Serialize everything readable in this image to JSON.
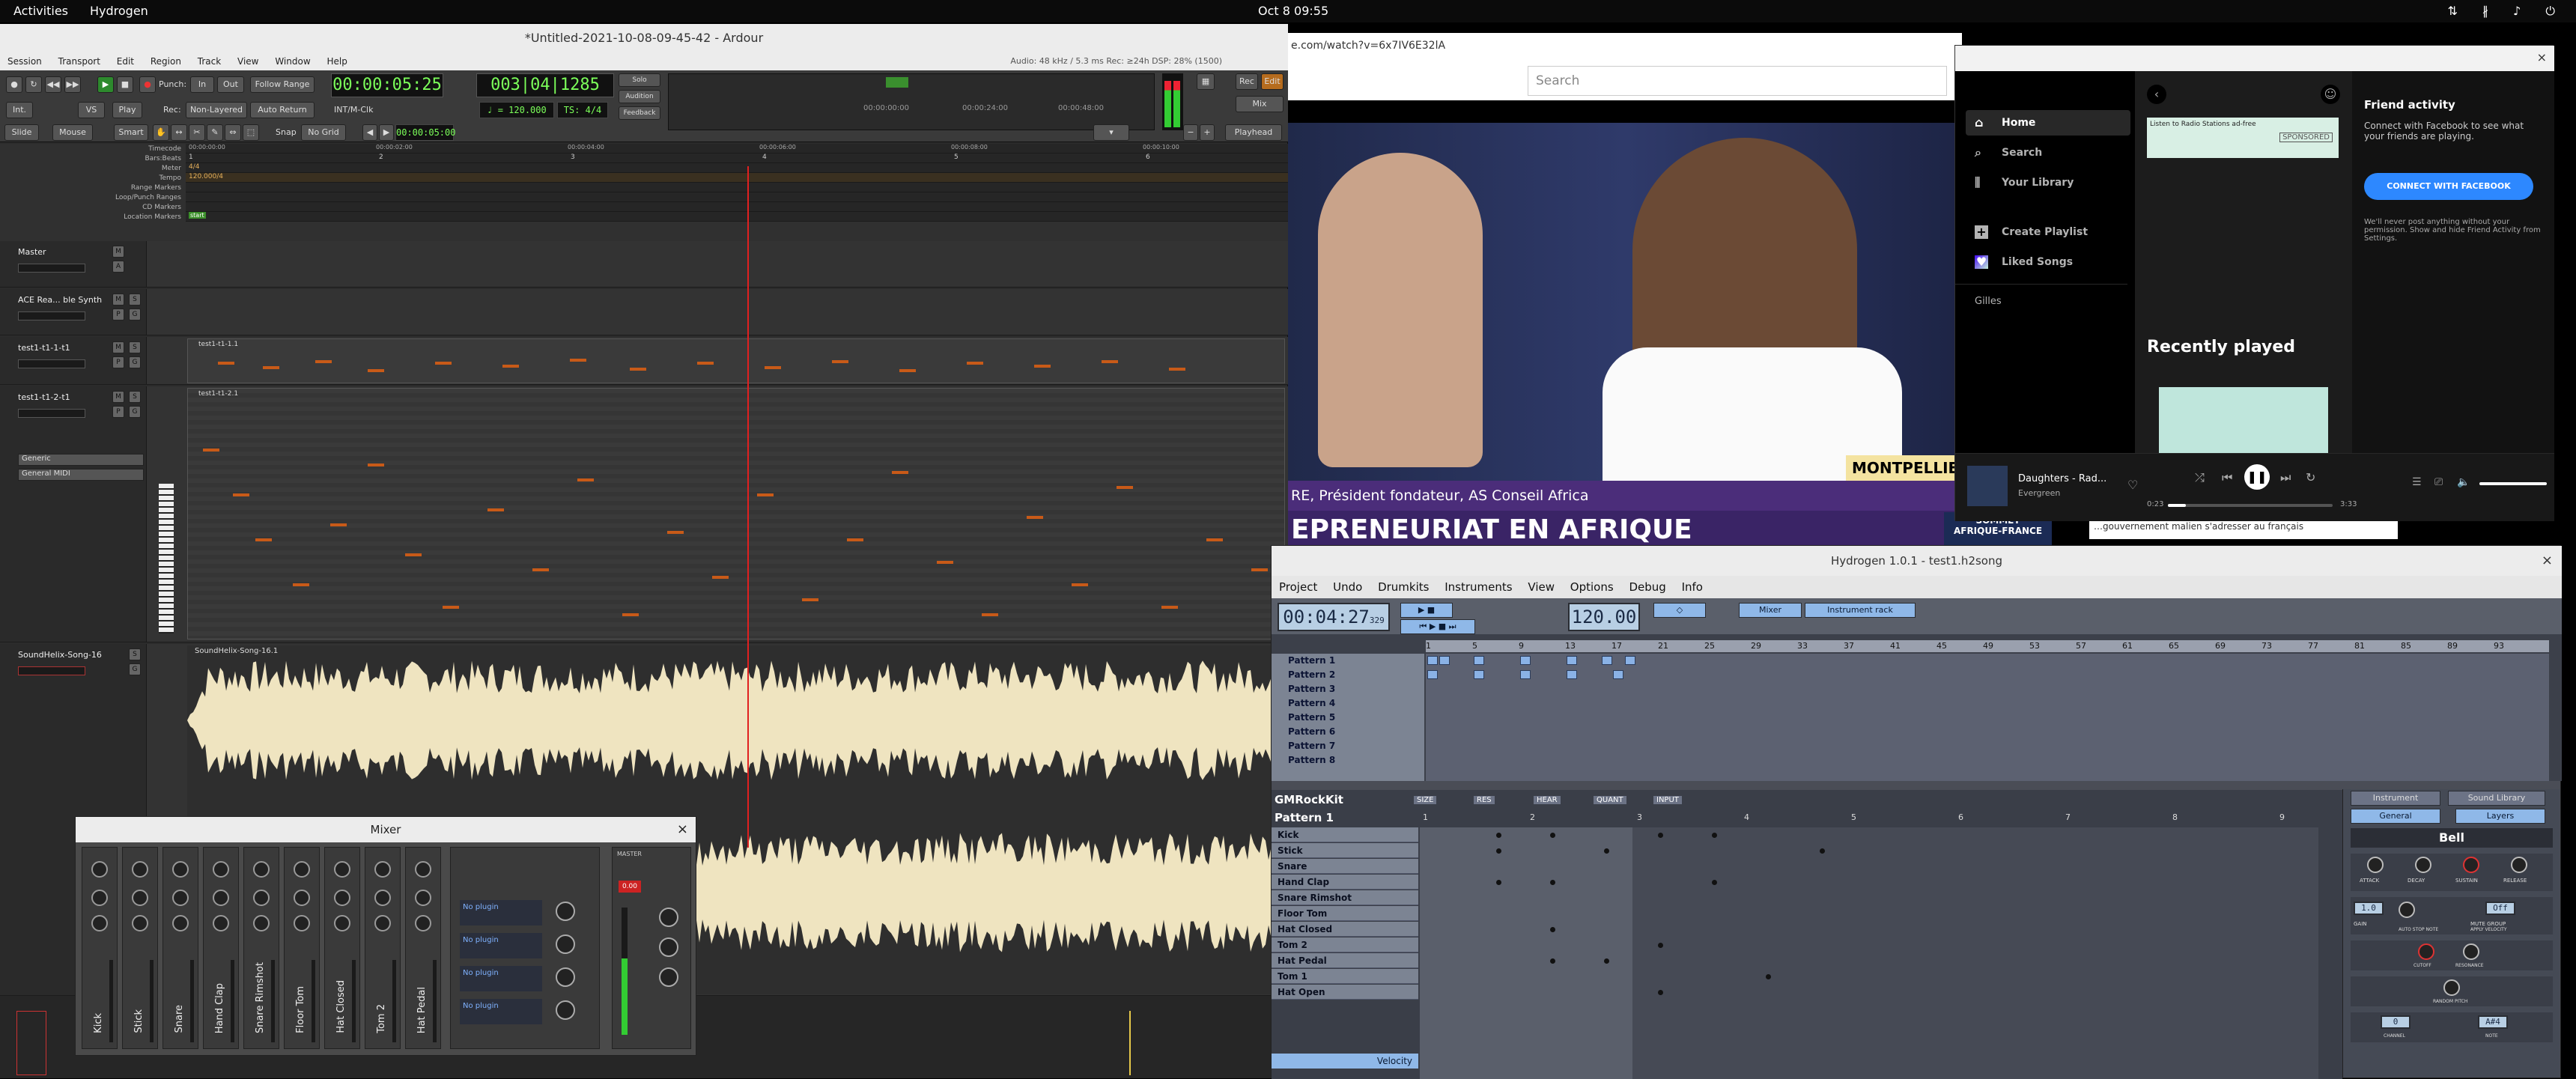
{
  "topbar": {
    "activities": "Activities",
    "app": "Hydrogen",
    "clock": "Oct 8  09:55",
    "tray": "⇅ ∦ ♪ ⏻"
  },
  "ardour": {
    "title": "*Untitled-2021-10-08-09-45-42 - Ardour",
    "menu": [
      "Session",
      "Transport",
      "Edit",
      "Region",
      "Track",
      "View",
      "Window",
      "Help"
    ],
    "status": "Audio: 48 kHz / 5.3 ms   Rec: ≥24h   DSP: 28% (1500)",
    "punch": "Punch:",
    "in": "In",
    "out": "Out",
    "follow": "Follow Range",
    "rec": "Rec:",
    "nonlayered": "Non-Layered",
    "autoreturn": "Auto Return",
    "play": "Play",
    "int": "Int.",
    "vs": "VS",
    "intmclk": "INT/M-Clk",
    "clock_primary": "00:00:05:25",
    "clock_secondary": "003|04|1285",
    "tempo": "♩ = 120.000",
    "ts": "TS: 4/4",
    "solo": "Solo",
    "audition": "Audition",
    "feedback": "Feedback",
    "mini_clocks": [
      "00:00:00:00",
      "00:00:24:00",
      "00:00:48:00"
    ],
    "rec_btn": "Rec",
    "edit_btn": "Edit",
    "mix_btn": "Mix",
    "slide": "Slide",
    "mouse": "Mouse",
    "smart": "Smart",
    "snap": "Snap",
    "nogrid": "No Grid",
    "nudge_clock": "00:00:05:00",
    "playhead": "Playhead",
    "ruler_labels": [
      "Timecode",
      "Bars:Beats",
      "Meter",
      "Tempo",
      "Range Markers",
      "Loop/Punch Ranges",
      "CD Markers",
      "Location Markers"
    ],
    "meter_value": "4/4",
    "tempo_value": "120.000/4",
    "tempo_value2": "4/4",
    "location_start": "start",
    "timecode_ticks": [
      "00:00:00:00",
      "00:00:02:00",
      "00:00:04:00",
      "00:00:06:00",
      "00:00:08:00",
      "00:00:10:00"
    ],
    "bar_ticks": [
      "1",
      "2",
      "3",
      "4",
      "5",
      "6"
    ],
    "tracks": [
      {
        "name": "Master"
      },
      {
        "name": "ACE Rea... ble Synth"
      },
      {
        "name": "test1-t1-1-t1"
      },
      {
        "name": "test1-t1-2-t1",
        "sub1": "Generic",
        "sub2": "General MIDI"
      },
      {
        "name": "SoundHelix-Song-16"
      }
    ],
    "region_names": [
      "test1-t1-1.1",
      "test1-t1-2.1",
      "SoundHelix-Song-16.1"
    ]
  },
  "mixer": {
    "title": "Mixer",
    "strips": [
      "Kick",
      "Stick",
      "Snare",
      "Hand Clap",
      "Snare Rimshot",
      "Floor Tom",
      "Hat Closed",
      "Tom 2",
      "Hat Pedal"
    ],
    "fx_labels": [
      "No plugin",
      "No plugin",
      "No plugin",
      "No plugin"
    ],
    "master_label": "MASTER",
    "peak": "0.00"
  },
  "youtube": {
    "address": "e.com/watch?v=6x7IV6E32lA",
    "search_placeholder": "Search",
    "place": "MONTPELLIER",
    "lower_name": "RE, Président fondateur, AS Conseil Africa",
    "lower_headline": "EPRENEURIAT EN AFRIQUE",
    "side_ad_line1": "SOMMET",
    "side_ad_line2": "AFRIQUE-FRANCE",
    "side_text": "…gouvernement malien s'adresser au français"
  },
  "spotify": {
    "nav": [
      {
        "label": "Home",
        "icon": "home-icon"
      },
      {
        "label": "Search",
        "icon": "search-icon"
      },
      {
        "label": "Your Library",
        "icon": "library-icon"
      }
    ],
    "create_playlist": "Create Playlist",
    "liked_songs": "Liked Songs",
    "user_playlist": "Gilles",
    "sponsored": "SPONSORED",
    "banner_text": "Listen to Radio Stations ad-free",
    "recently_played": "Recently played",
    "friend_title": "Friend activity",
    "friend_text": "Connect with Facebook to see what your friends are playing.",
    "fb_button": "CONNECT WITH FACEBOOK",
    "friend_note": "We'll never post anything without your permission. Show and hide Friend Activity from Settings.",
    "track_title": "Daughters - Rad...",
    "track_artist": "Evergreen",
    "time_elapsed": "0:23",
    "time_total": "3:33",
    "progress": 0.11
  },
  "hydrogen": {
    "title": "Hydrogen 1.0.1 - test1.h2song",
    "menu": [
      "Project",
      "Undo",
      "Drumkits",
      "Instruments",
      "View",
      "Options",
      "Debug",
      "Info"
    ],
    "time": "00:04:27",
    "time_ms": "329",
    "bpm": "120.00",
    "mixer_btn": "Mixer",
    "rack_btn": "Instrument rack",
    "patterns": [
      "Pattern 1",
      "Pattern 2",
      "Pattern 3",
      "Pattern 4",
      "Pattern 5",
      "Pattern 6",
      "Pattern 7",
      "Pattern 8"
    ],
    "pattern_bar_numbers": [
      "1",
      "5",
      "9",
      "13",
      "17",
      "21",
      "25",
      "29",
      "33",
      "37",
      "41",
      "45",
      "49",
      "53",
      "57",
      "61",
      "65",
      "69",
      "73",
      "77",
      "81",
      "85",
      "89",
      "93"
    ],
    "drumkit": "GMRockKit",
    "current_pattern": "Pattern 1",
    "editor_controls": [
      "SIZE",
      "RES",
      "HEAR",
      "QUANT",
      "INPUT"
    ],
    "beat_numbers": [
      "1",
      "2",
      "3",
      "4",
      "5",
      "6",
      "7",
      "8",
      "9"
    ],
    "instruments": [
      "Kick",
      "Stick",
      "Snare",
      "Hand Clap",
      "Snare Rimshot",
      "Floor Tom",
      "Hat Closed",
      "Tom 2",
      "Hat Pedal",
      "Tom 1",
      "Hat Open"
    ],
    "velocity_label": "Velocity",
    "inst_tabs": [
      "Instrument",
      "Sound Library"
    ],
    "inst_subtabs": [
      "General",
      "Layers"
    ],
    "inst_name": "Bell",
    "adsr": [
      "ATTACK",
      "DECAY",
      "SUSTAIN",
      "RELEASE"
    ],
    "panel_labels": [
      "GAIN",
      "MUTE GROUP",
      "AUTO STOP NOTE",
      "APPLY VELOCITY",
      "CUTOFF",
      "RESONANCE",
      "RANDOM PITCH",
      "CHANNEL",
      "NOTE"
    ],
    "gain_value": "1.0",
    "mute_group": "Off",
    "channel": "0",
    "note": "A#4"
  },
  "colors": {
    "ardour_bg": "#2b2b2b",
    "midi_note": "#c85a18",
    "wave": "#efe4c0",
    "playhead": "#e02020",
    "hydrogen_cell": "#8ab2e6",
    "fb_blue": "#2d88ff",
    "spotify_bg": "#121212"
  }
}
